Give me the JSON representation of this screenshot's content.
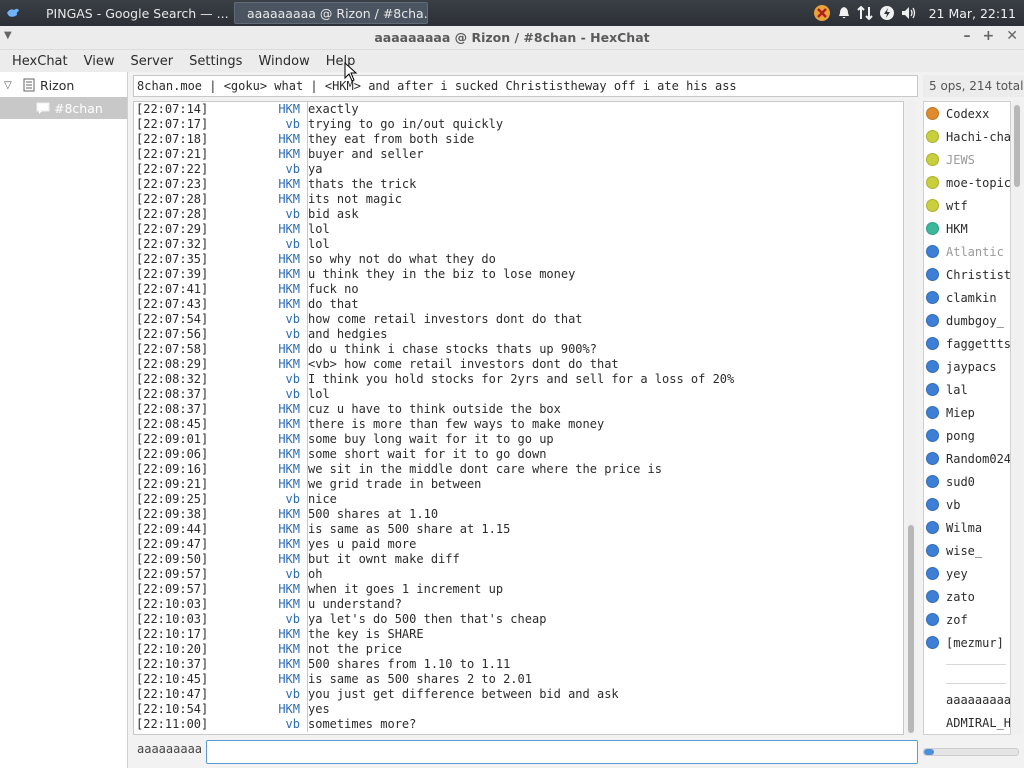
{
  "taskbar": {
    "tasks": [
      {
        "label": "PINGAS - Google Search — ...",
        "icon": "firefox-icon"
      },
      {
        "label": "aaaaaaaaa @ Rizon / #8cha...",
        "icon": "hexchat-icon"
      }
    ],
    "clock": "21 Mar, 22:11"
  },
  "window": {
    "title": "aaaaaaaaa @ Rizon / #8chan - HexChat"
  },
  "menu": {
    "items": [
      "HexChat",
      "View",
      "Server",
      "Settings",
      "Window",
      "Help"
    ]
  },
  "tree": {
    "network": "Rizon",
    "channel": "#8chan"
  },
  "topic": "8chan.moe | <goku> what | <HKM> and after i sucked Christistheway off i ate his ass",
  "user_count": "5 ops, 214 total",
  "messages": [
    {
      "ts": "[22:07:14]",
      "nick": "HKM",
      "msg": "exactly"
    },
    {
      "ts": "[22:07:17]",
      "nick": "vb",
      "msg": "trying to go in/out quickly"
    },
    {
      "ts": "[22:07:18]",
      "nick": "HKM",
      "msg": "they eat from both side"
    },
    {
      "ts": "[22:07:21]",
      "nick": "HKM",
      "msg": "buyer and seller"
    },
    {
      "ts": "[22:07:22]",
      "nick": "vb",
      "msg": "ya"
    },
    {
      "ts": "[22:07:23]",
      "nick": "HKM",
      "msg": "thats the trick"
    },
    {
      "ts": "[22:07:28]",
      "nick": "HKM",
      "msg": "its not magic"
    },
    {
      "ts": "[22:07:28]",
      "nick": "vb",
      "msg": "bid ask"
    },
    {
      "ts": "[22:07:29]",
      "nick": "HKM",
      "msg": "lol"
    },
    {
      "ts": "[22:07:32]",
      "nick": "vb",
      "msg": "lol"
    },
    {
      "ts": "[22:07:35]",
      "nick": "HKM",
      "msg": "so why not do what they do"
    },
    {
      "ts": "[22:07:39]",
      "nick": "HKM",
      "msg": "u think they in the biz to lose money"
    },
    {
      "ts": "[22:07:41]",
      "nick": "HKM",
      "msg": "fuck no"
    },
    {
      "ts": "[22:07:43]",
      "nick": "HKM",
      "msg": "do that"
    },
    {
      "ts": "[22:07:54]",
      "nick": "vb",
      "msg": "how come retail investors dont do that"
    },
    {
      "ts": "[22:07:56]",
      "nick": "vb",
      "msg": "and hedgies"
    },
    {
      "ts": "[22:07:58]",
      "nick": "HKM",
      "msg": "do u think i chase stocks thats up 900%?"
    },
    {
      "ts": "[22:08:29]",
      "nick": "HKM",
      "msg": "<vb> how come retail investors dont do that"
    },
    {
      "ts": "[22:08:32]",
      "nick": "vb",
      "msg": "I think you hold stocks for 2yrs and sell for a loss of 20%"
    },
    {
      "ts": "[22:08:37]",
      "nick": "vb",
      "msg": "lol"
    },
    {
      "ts": "[22:08:37]",
      "nick": "HKM",
      "msg": "cuz u have to think outside the box"
    },
    {
      "ts": "[22:08:45]",
      "nick": "HKM",
      "msg": "there is more than few ways to make money"
    },
    {
      "ts": "[22:09:01]",
      "nick": "HKM",
      "msg": "some buy long wait for it to go up"
    },
    {
      "ts": "[22:09:06]",
      "nick": "HKM",
      "msg": "some short wait for it to go down"
    },
    {
      "ts": "[22:09:16]",
      "nick": "HKM",
      "msg": "we sit in the middle dont care where the price is"
    },
    {
      "ts": "[22:09:21]",
      "nick": "HKM",
      "msg": "we grid trade in between"
    },
    {
      "ts": "[22:09:25]",
      "nick": "vb",
      "msg": "nice"
    },
    {
      "ts": "[22:09:38]",
      "nick": "HKM",
      "msg": "500 shares at 1.10"
    },
    {
      "ts": "[22:09:44]",
      "nick": "HKM",
      "msg": "is same as 500 share at 1.15"
    },
    {
      "ts": "[22:09:47]",
      "nick": "HKM",
      "msg": "yes u paid more"
    },
    {
      "ts": "[22:09:50]",
      "nick": "HKM",
      "msg": "but it ownt make diff"
    },
    {
      "ts": "[22:09:57]",
      "nick": "vb",
      "msg": "oh"
    },
    {
      "ts": "[22:09:57]",
      "nick": "HKM",
      "msg": "when it goes 1 increment up"
    },
    {
      "ts": "[22:10:03]",
      "nick": "HKM",
      "msg": "u understand?"
    },
    {
      "ts": "[22:10:03]",
      "nick": "vb",
      "msg": "ya let's do 500 then that's cheap"
    },
    {
      "ts": "[22:10:17]",
      "nick": "HKM",
      "msg": "the key is SHARE"
    },
    {
      "ts": "[22:10:20]",
      "nick": "HKM",
      "msg": "not the price"
    },
    {
      "ts": "[22:10:37]",
      "nick": "HKM",
      "msg": "500 shares from 1.10 to 1.11"
    },
    {
      "ts": "[22:10:45]",
      "nick": "HKM",
      "msg": "is same as 500 shares 2 to 2.01"
    },
    {
      "ts": "[22:10:47]",
      "nick": "vb",
      "msg": "you just get difference between bid and ask"
    },
    {
      "ts": "[22:10:54]",
      "nick": "HKM",
      "msg": "yes"
    },
    {
      "ts": "[22:11:00]",
      "nick": "vb",
      "msg": "sometimes more?"
    }
  ],
  "users": [
    {
      "name": "Codexx",
      "color": "#e08a2c",
      "away": false
    },
    {
      "name": "Hachi-cha",
      "color": "#c9cf3a",
      "away": false
    },
    {
      "name": "JEWS",
      "color": "#c9cf3a",
      "away": true
    },
    {
      "name": "moe-topic",
      "color": "#c9cf3a",
      "away": false
    },
    {
      "name": "wtf",
      "color": "#c9cf3a",
      "away": false
    },
    {
      "name": "HKM",
      "color": "#3bb89a",
      "away": false
    },
    {
      "name": "Atlantic",
      "color": "#3d7fd6",
      "away": true
    },
    {
      "name": "Christist",
      "color": "#3d7fd6",
      "away": false
    },
    {
      "name": "clamkin",
      "color": "#3d7fd6",
      "away": false
    },
    {
      "name": "dumbgoy_",
      "color": "#3d7fd6",
      "away": false
    },
    {
      "name": "faggettts",
      "color": "#3d7fd6",
      "away": false
    },
    {
      "name": "jaypacs",
      "color": "#3d7fd6",
      "away": false
    },
    {
      "name": "lal",
      "color": "#3d7fd6",
      "away": false
    },
    {
      "name": "Miep",
      "color": "#3d7fd6",
      "away": false
    },
    {
      "name": "pong",
      "color": "#3d7fd6",
      "away": false
    },
    {
      "name": "Random024",
      "color": "#3d7fd6",
      "away": false
    },
    {
      "name": "sud0",
      "color": "#3d7fd6",
      "away": false
    },
    {
      "name": "vb",
      "color": "#3d7fd6",
      "away": false
    },
    {
      "name": "Wilma",
      "color": "#3d7fd6",
      "away": false
    },
    {
      "name": "wise_",
      "color": "#3d7fd6",
      "away": false
    },
    {
      "name": "yey",
      "color": "#3d7fd6",
      "away": false
    },
    {
      "name": "zato",
      "color": "#3d7fd6",
      "away": false
    },
    {
      "name": "zof",
      "color": "#3d7fd6",
      "away": false
    },
    {
      "name": "[mezmur]",
      "color": "#3d7fd6",
      "away": false
    }
  ],
  "users_plain": [
    "aaaaaaaaa",
    "ADMIRAL_H"
  ],
  "input": {
    "nick": "aaaaaaaaa",
    "value": "",
    "placeholder": ""
  },
  "colors": {
    "nick": "#2d6cb5",
    "accent": "#5b9bd5"
  }
}
